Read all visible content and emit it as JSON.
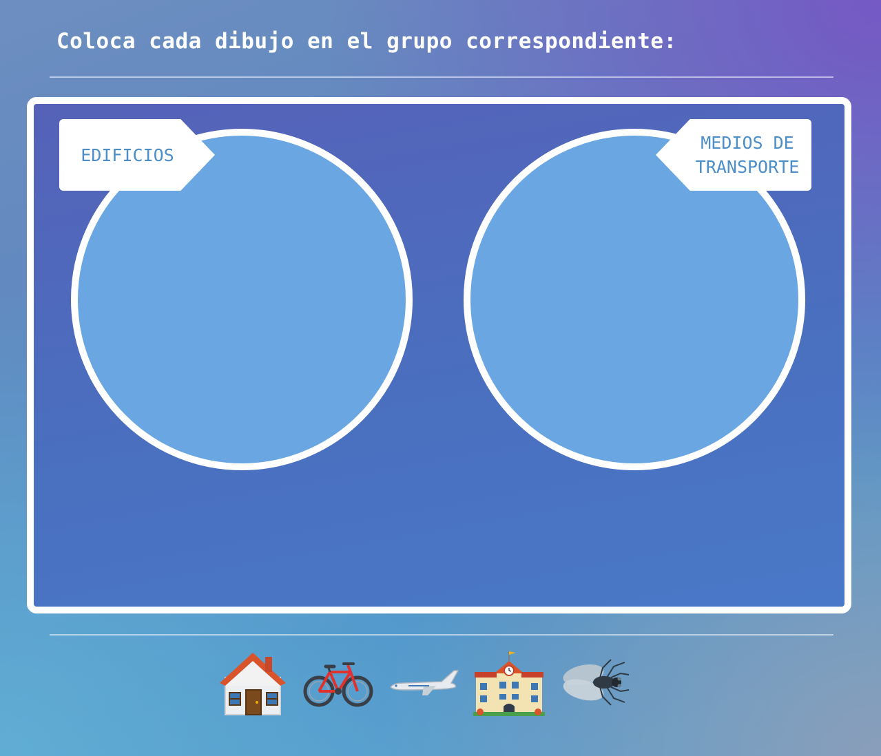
{
  "instruction": "Coloca cada dibujo en el grupo correspondiente:",
  "groups": [
    {
      "label_lines": [
        "EDIFICIOS"
      ]
    },
    {
      "label_lines": [
        "MEDIOS DE",
        "TRANSPORTE"
      ]
    }
  ],
  "items": [
    {
      "icon": "house-icon"
    },
    {
      "icon": "bicycle-icon"
    },
    {
      "icon": "airplane-icon"
    },
    {
      "icon": "school-icon"
    },
    {
      "icon": "fly-icon"
    }
  ],
  "colors": {
    "board_border": "#ffffff",
    "board_fill": "#4a6fbf",
    "circle_fill": "#6aa7e2",
    "label_text": "#4b8ec8"
  }
}
